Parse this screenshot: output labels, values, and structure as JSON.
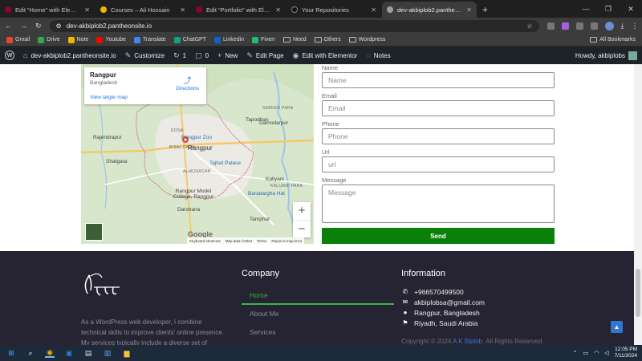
{
  "browser": {
    "tabs": [
      {
        "title": "Edit “Home” with Elementor",
        "color": "#92003b"
      },
      {
        "title": "Courses – Ali Hossain",
        "color": "#f4b400"
      },
      {
        "title": "Edit “Portfolio” with Elementor",
        "color": "#92003b"
      },
      {
        "title": "Your Repositories",
        "color": "#1f1f1f"
      },
      {
        "title": "dev-akbiplob2.pantheonsite.io",
        "color": "#5f6368"
      }
    ],
    "url": "dev-akbiplob2.pantheonsite.io",
    "bookmarks": [
      {
        "label": "Gmail",
        "color": "#ea4335"
      },
      {
        "label": "Drive",
        "color": "#34a853"
      },
      {
        "label": "Note",
        "color": "#f4b400"
      },
      {
        "label": "Youtube",
        "color": "#ff0000"
      },
      {
        "label": "Translate",
        "color": "#4285f4"
      },
      {
        "label": "ChatGPT",
        "color": "#10a37f"
      },
      {
        "label": "Linkedin",
        "color": "#0a66c2"
      },
      {
        "label": "Fiverr",
        "color": "#1dbf73"
      },
      {
        "label": "Need",
        "folder": true
      },
      {
        "label": "Others",
        "folder": true
      },
      {
        "label": "Wordpress",
        "folder": true
      }
    ],
    "all_bookmarks": "All Bookmarks"
  },
  "wpbar": {
    "site": "dev-akbiplob2.pantheonsite.io",
    "customize": "Customize",
    "updates": "1",
    "comments": "0",
    "new": "New",
    "edit_page": "Edit Page",
    "edit_elementor": "Edit with Elementor",
    "notes": "Notes",
    "howdy": "Howdy, akbiplobs"
  },
  "map": {
    "place": "Rangpur",
    "country": "Bangladesh",
    "directions": "Directions",
    "view_larger": "View larger map",
    "google": "Google",
    "attribution": [
      "Keyboard shortcuts",
      "Map data ©2024",
      "Terms",
      "Report a map error"
    ],
    "labels": {
      "tapodhan": "Tapodhan",
      "dosa": "DOSA",
      "sarker_para": "SARKER PARA",
      "rajendrapur": "Rajendrapur",
      "rangpur_zoo": "Rangpur Zoo",
      "bisal_para": "BISAL PARA",
      "rangpur": "Rangpur",
      "shatgara": "Shatgara",
      "almonagar": "ALMONAGAR",
      "tajhat_palace": "Tajhat Palace",
      "kaliyani": "Kaliyani",
      "kalijani_para": "KALIJANI PARA",
      "rangpur_model_college": "Rangpur Model College, Rangpur",
      "baradargha": "Baradargha Hat",
      "darshana": "Darshana",
      "tamphat": "Tamphat",
      "damodarpur": "Damodarpur"
    }
  },
  "form": {
    "name_label": "Name",
    "name_placeholder": "Name",
    "email_label": "Email",
    "email_placeholder": "Email",
    "phone_label": "Phone",
    "phone_placeholder": "Phone",
    "url_label": "Url",
    "url_placeholder": "url",
    "message_label": "Message",
    "message_placeholder": "Message",
    "send": "Send"
  },
  "footer": {
    "about": "As a WordPress web developer, I combine technical skills to improve clients' online presence. My services typically include a diverse set of offerings such as",
    "company_title": "Company",
    "menu": [
      "Home",
      "About Me",
      "Services"
    ],
    "info_title": "Information",
    "phone": "+966570499500",
    "email": "akbiplobsa@gmail.com",
    "location1": "Rangpur, Bangladesh",
    "location2": "Riyadh, Saudi Arabia",
    "copyright_prefix": "Copyright © 2024",
    "copyright_brand": "A K Biplob",
    "copyright_suffix": ". All Rights Reserved."
  },
  "taskbar": {
    "time": "12:05 PM",
    "date": "7/11/2024"
  },
  "colors": {
    "accent_green": "#0a7f0a",
    "footer_bg": "#262433",
    "wpbar_bg": "#1d2327"
  }
}
